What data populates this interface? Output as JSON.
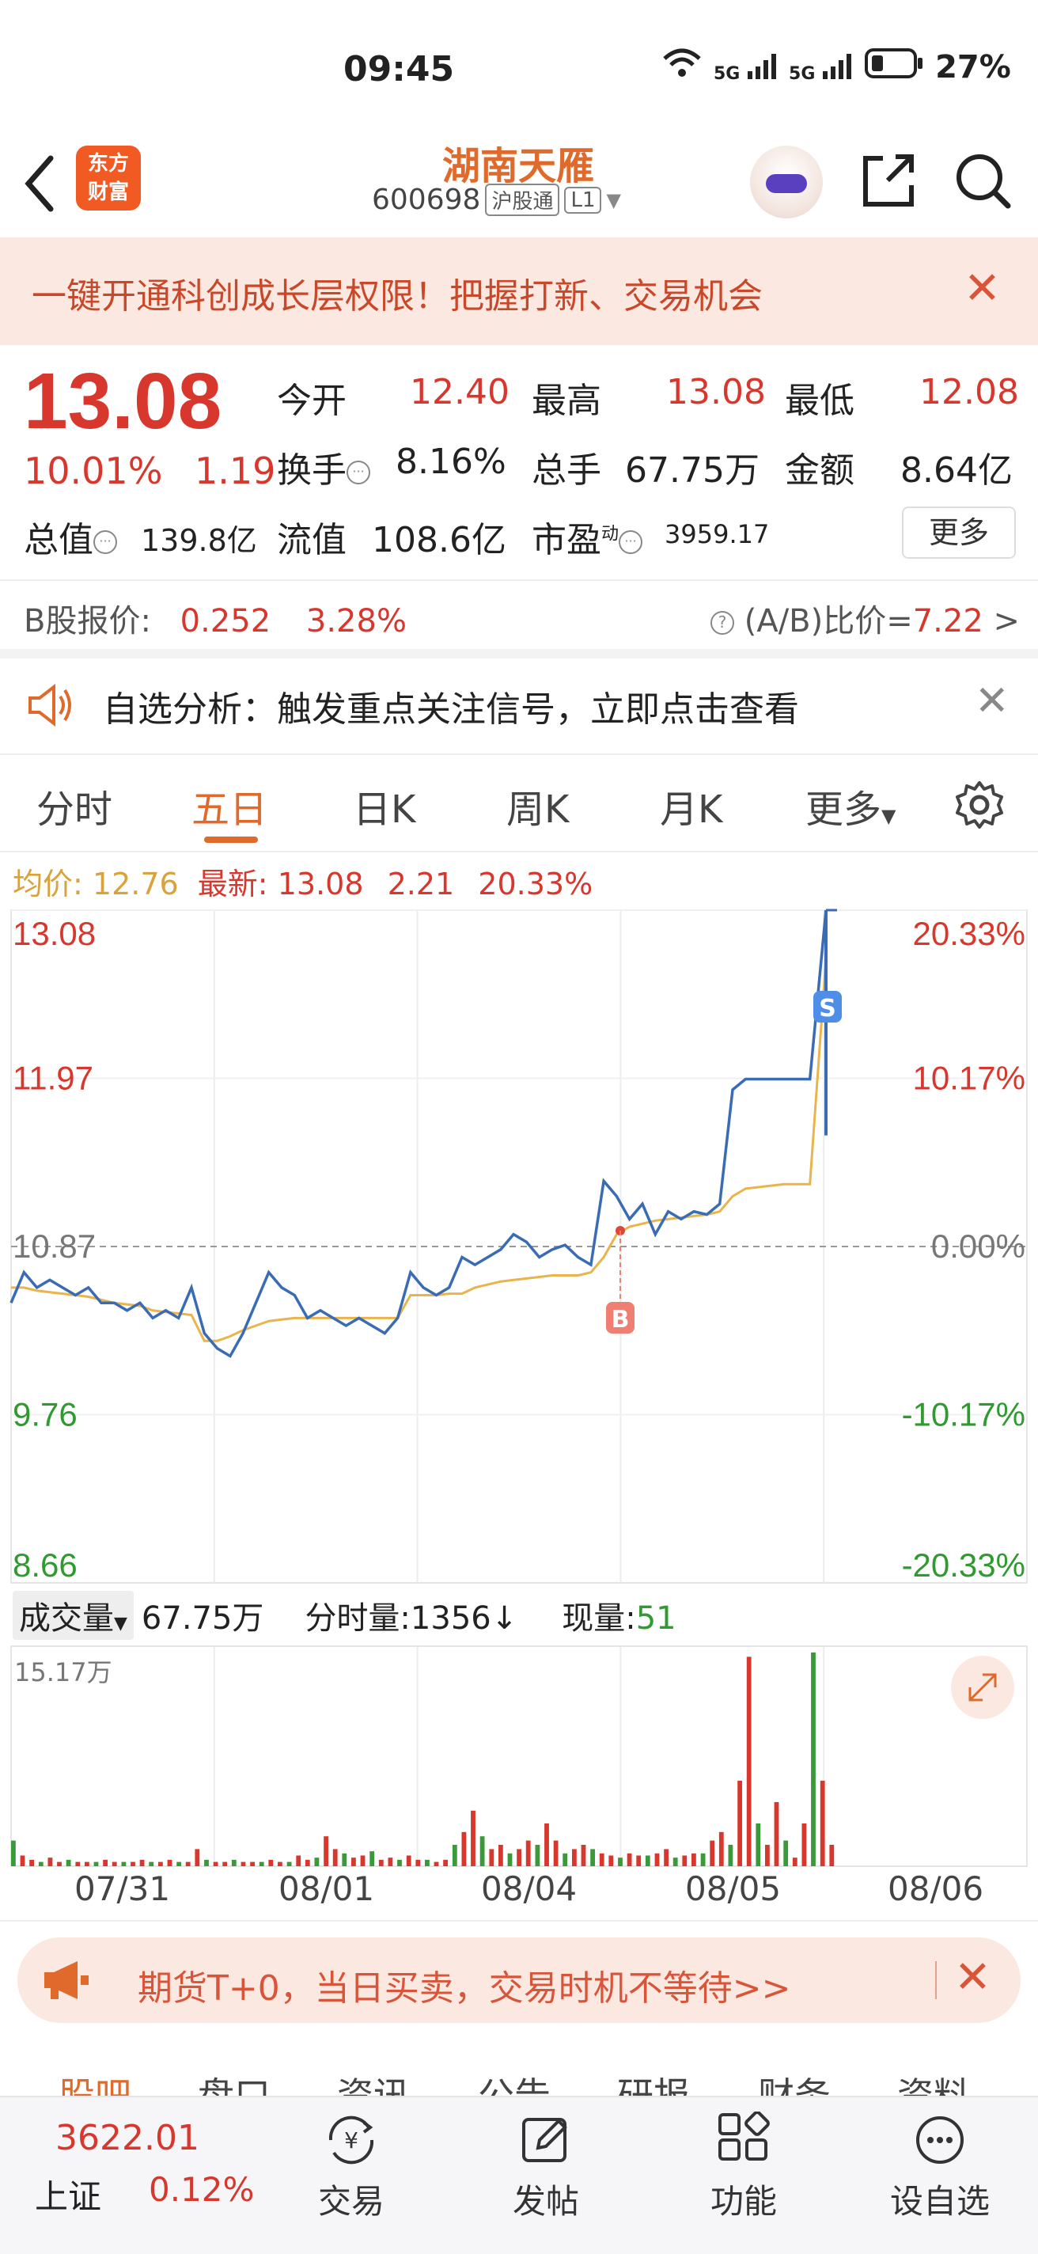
{
  "status_bar": {
    "time": "09:45",
    "net1": "5G",
    "net2": "5G",
    "battery": "27%"
  },
  "header": {
    "logo_text": "东方\n财富",
    "stock_name": "湖南天雁",
    "stock_code": "600698",
    "exchange_tag": "沪股通",
    "level_tag": "L1"
  },
  "banner": {
    "text": "一键开通科创成长层权限！把握打新、交易机会"
  },
  "quote": {
    "price": "13.08",
    "change_pct": "10.01%",
    "change_amt": "1.19",
    "open_label": "今开",
    "open": "12.40",
    "high_label": "最高",
    "high": "13.08",
    "low_label": "最低",
    "low": "12.08",
    "turnover_label": "换手",
    "turnover": "8.16%",
    "volume_label": "总手",
    "volume": "67.75万",
    "amount_label": "金额",
    "amount": "8.64亿",
    "mktcap_label": "总值",
    "mktcap": "139.8亿",
    "float_label": "流值",
    "float": "108.6亿",
    "pe_label": "市盈",
    "pe_sup": "动",
    "pe": "3959.17",
    "more": "更多"
  },
  "b_share": {
    "label": "B股报价:",
    "price": "0.252",
    "pct": "3.28%",
    "ratio_label": "(A/B)比价=",
    "ratio": "7.22",
    "arrow": ">"
  },
  "analysis": {
    "text": "自选分析：触发重点关注信号，立即点击查看"
  },
  "tabs": [
    {
      "label": "分时"
    },
    {
      "label": "五日"
    },
    {
      "label": "日K"
    },
    {
      "label": "周K"
    },
    {
      "label": "月K"
    },
    {
      "label": "更多"
    }
  ],
  "avg_line": {
    "avg_label": "均价:",
    "avg": "12.76",
    "latest_label": "最新:",
    "latest": "13.08",
    "chg": "2.21",
    "pct": "20.33%"
  },
  "chart_data": {
    "type": "line",
    "title": "",
    "y_left_ticks": [
      "13.08",
      "11.97",
      "10.87",
      "9.76",
      "8.66"
    ],
    "y_right_ticks": [
      "20.33%",
      "10.17%",
      "0.00%",
      "-10.17%",
      "-20.33%"
    ],
    "ylim": [
      8.66,
      13.08
    ],
    "base_price": 10.87,
    "x_labels": [
      "07/31",
      "08/01",
      "08/04",
      "08/05",
      "08/06"
    ],
    "series": [
      {
        "name": "最新",
        "color": "#3a6bb5",
        "values": [
          10.5,
          10.7,
          10.6,
          10.65,
          10.6,
          10.55,
          10.6,
          10.5,
          10.5,
          10.45,
          10.5,
          10.4,
          10.45,
          10.4,
          10.6,
          10.3,
          10.2,
          10.15,
          10.3,
          10.5,
          10.7,
          10.6,
          10.55,
          10.4,
          10.45,
          10.4,
          10.35,
          10.4,
          10.35,
          10.3,
          10.4,
          10.7,
          10.6,
          10.55,
          10.6,
          10.8,
          10.75,
          10.8,
          10.85,
          10.95,
          10.9,
          10.8,
          10.85,
          10.88,
          10.8,
          10.75,
          11.3,
          11.2,
          11.05,
          11.15,
          10.95,
          11.1,
          11.05,
          11.1,
          11.08,
          11.15,
          11.9,
          11.97,
          11.97,
          11.97,
          11.97,
          11.97,
          11.97,
          13.08
        ]
      },
      {
        "name": "均价",
        "color": "#e9b44c",
        "values": [
          10.6,
          10.6,
          10.58,
          10.57,
          10.56,
          10.55,
          10.54,
          10.52,
          10.5,
          10.49,
          10.48,
          10.45,
          10.44,
          10.43,
          10.42,
          10.25,
          10.25,
          10.28,
          10.32,
          10.35,
          10.38,
          10.39,
          10.4,
          10.4,
          10.4,
          10.4,
          10.4,
          10.4,
          10.4,
          10.4,
          10.4,
          10.55,
          10.55,
          10.55,
          10.56,
          10.56,
          10.6,
          10.62,
          10.64,
          10.65,
          10.66,
          10.67,
          10.68,
          10.68,
          10.68,
          10.7,
          10.8,
          10.95,
          11.0,
          11.02,
          11.04,
          11.05,
          11.06,
          11.07,
          11.08,
          11.1,
          11.2,
          11.25,
          11.26,
          11.27,
          11.28,
          11.28,
          11.28,
          12.76
        ]
      }
    ],
    "markers": [
      {
        "label": "B",
        "color": "#ef7f72"
      },
      {
        "label": "S",
        "color": "#4f8ee8"
      }
    ],
    "volume": {
      "label": "成交量",
      "total": "67.75万",
      "tick_label": "分时量:",
      "tick": "1356",
      "now_label": "现量:",
      "now": "51",
      "max_label": "15.17万",
      "bars": [
        0.12,
        0.05,
        0.03,
        0.02,
        0.04,
        0.02,
        0.03,
        0.02,
        0.02,
        0.02,
        0.03,
        0.02,
        0.02,
        0.02,
        0.03,
        0.02,
        0.02,
        0.03,
        0.02,
        0.02,
        0.08,
        0.03,
        0.02,
        0.02,
        0.03,
        0.02,
        0.02,
        0.02,
        0.03,
        0.02,
        0.02,
        0.05,
        0.03,
        0.04,
        0.14,
        0.08,
        0.06,
        0.04,
        0.05,
        0.07,
        0.03,
        0.04,
        0.03,
        0.05,
        0.03,
        0.03,
        0.02,
        0.03,
        0.1,
        0.16,
        0.26,
        0.14,
        0.08,
        0.1,
        0.06,
        0.08,
        0.12,
        0.1,
        0.2,
        0.12,
        0.06,
        0.08,
        0.1,
        0.08,
        0.06,
        0.05,
        0.04,
        0.06,
        0.05,
        0.05,
        0.06,
        0.08,
        0.04,
        0.05,
        0.06,
        0.06,
        0.12,
        0.16,
        0.1,
        0.4,
        0.98,
        0.2,
        0.1,
        0.3,
        0.12,
        0.04,
        0.2,
        1.0,
        0.4,
        0.1
      ]
    }
  },
  "promo": {
    "text": "期货T+0，当日买卖，交易时机不等待>>"
  },
  "bottom_tabs": [
    "股吧",
    "盘口",
    "资讯",
    "公告",
    "研报",
    "财务",
    "资料"
  ],
  "bottom_nav": {
    "index_value": "3622.01",
    "index_name": "上证",
    "index_pct": "0.12%",
    "items": [
      {
        "label": "交易"
      },
      {
        "label": "发帖"
      },
      {
        "label": "功能"
      },
      {
        "label": "设自选"
      }
    ]
  }
}
